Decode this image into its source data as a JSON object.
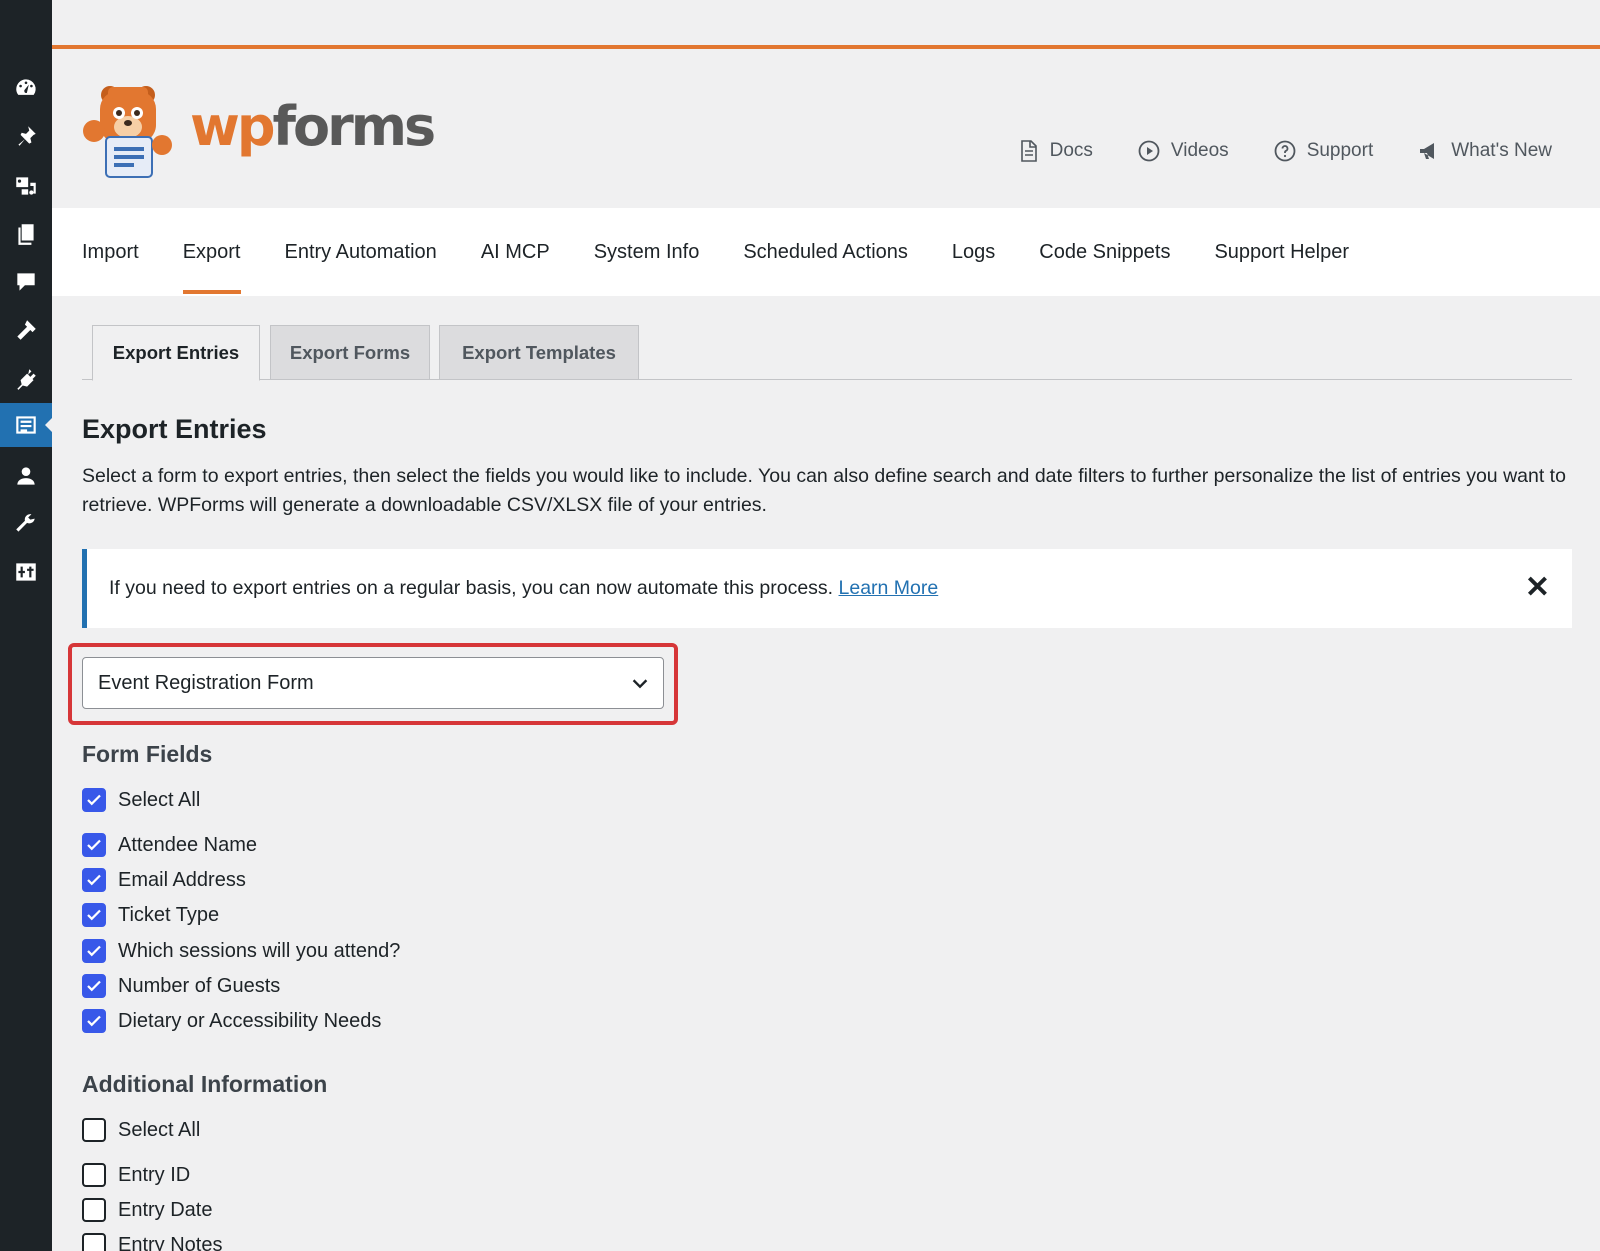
{
  "brand": {
    "wp": "wp",
    "forms": "forms",
    "accent_color": "#e27730"
  },
  "sidebar": {
    "icons": [
      "dashboard-icon",
      "pin-icon",
      "media-icon",
      "pages-icon",
      "comments-icon",
      "appearance-icon",
      "plugins-icon",
      "wpforms-icon",
      "users-icon",
      "tools-icon",
      "settings-icon"
    ],
    "active_index": 7
  },
  "header_links": [
    {
      "label": "Docs",
      "icon": "document-icon"
    },
    {
      "label": "Videos",
      "icon": "play-icon"
    },
    {
      "label": "Support",
      "icon": "question-icon"
    },
    {
      "label": "What's New",
      "icon": "megaphone-icon"
    }
  ],
  "nav": {
    "items": [
      "Import",
      "Export",
      "Entry Automation",
      "AI MCP",
      "System Info",
      "Scheduled Actions",
      "Logs",
      "Code Snippets",
      "Support Helper"
    ],
    "active": "Export"
  },
  "subtabs": {
    "items": [
      "Export Entries",
      "Export Forms",
      "Export Templates"
    ],
    "active": "Export Entries"
  },
  "page": {
    "title": "Export Entries",
    "description": "Select a form to export entries, then select the fields you would like to include. You can also define search and date filters to further personalize the list of entries you want to retrieve. WPForms will generate a downloadable CSV/XLSX file of your entries."
  },
  "notice": {
    "text": "If you need to export entries on a regular basis, you can now automate this process.",
    "link": "Learn More",
    "close": "✕"
  },
  "form_select": {
    "value": "Event Registration Form"
  },
  "form_fields": {
    "title": "Form Fields",
    "select_all": {
      "label": "Select All",
      "checked": true
    },
    "items": [
      {
        "label": "Attendee Name",
        "checked": true
      },
      {
        "label": "Email Address",
        "checked": true
      },
      {
        "label": "Ticket Type",
        "checked": true
      },
      {
        "label": "Which sessions will you attend?",
        "checked": true
      },
      {
        "label": "Number of Guests",
        "checked": true
      },
      {
        "label": "Dietary or Accessibility Needs",
        "checked": true
      }
    ]
  },
  "additional_info": {
    "title": "Additional Information",
    "select_all": {
      "label": "Select All",
      "checked": false
    },
    "items": [
      {
        "label": "Entry ID",
        "checked": false
      },
      {
        "label": "Entry Date",
        "checked": false
      },
      {
        "label": "Entry Notes",
        "checked": false
      }
    ]
  }
}
